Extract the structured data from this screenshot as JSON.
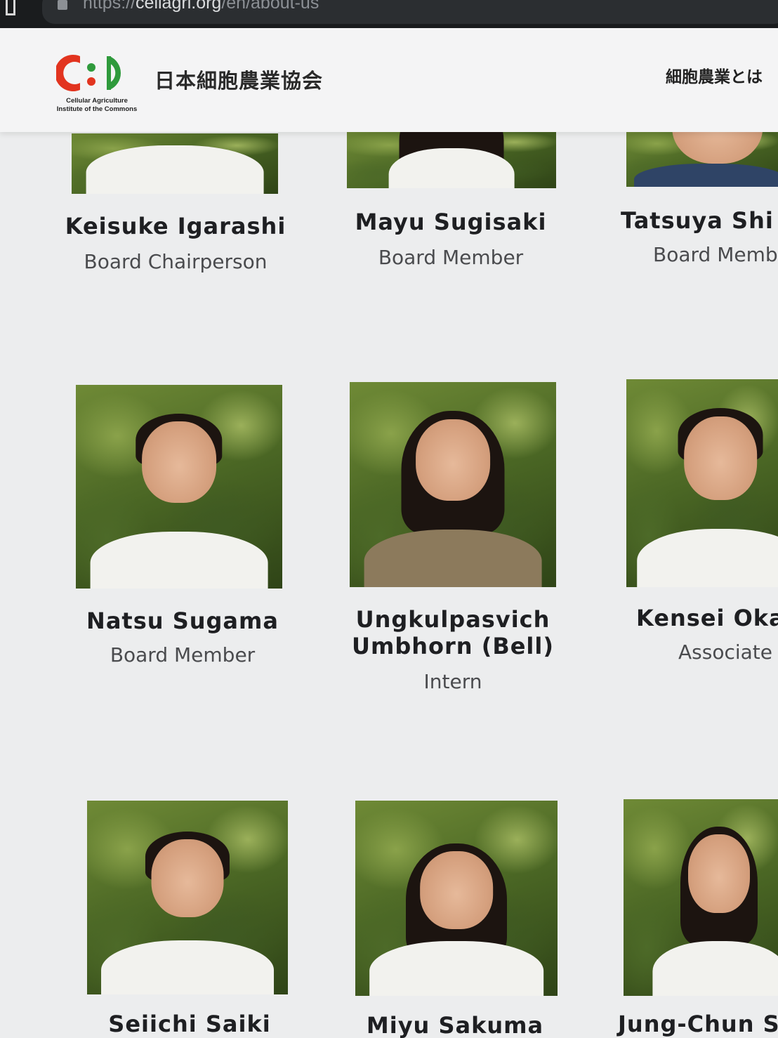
{
  "browser": {
    "url_prefix": "https://",
    "url_host": "cellagri.org",
    "url_path": "/en/about-us"
  },
  "header": {
    "logo_caption_line1": "Cellular Agriculture",
    "logo_caption_line2": "Institute of the Commons",
    "site_name": "日本細胞農業協会",
    "nav_item": "細胞農業とは"
  },
  "colors": {
    "logo_red": "#e2341f",
    "logo_green": "#2f9a3c",
    "page_background": "#ecedee",
    "header_background": "#f4f4f5"
  },
  "members": [
    {
      "name": "Keisuke Igarashi",
      "role": "Board Chairperson"
    },
    {
      "name": "Mayu Sugisaki",
      "role": "Board Member"
    },
    {
      "name": "Tatsuya Shi",
      "role": "Board Memb"
    },
    {
      "name": "Natsu Sugama",
      "role": "Board Member"
    },
    {
      "name_line1": "Ungkulpasvich",
      "name_line2": "Umbhorn (Bell)",
      "role": "Intern"
    },
    {
      "name": "Kensei Oka",
      "role": "Associate"
    },
    {
      "name": "Seiichi Saiki"
    },
    {
      "name": "Miyu Sakuma"
    },
    {
      "name": "Jung-Chun S"
    }
  ]
}
